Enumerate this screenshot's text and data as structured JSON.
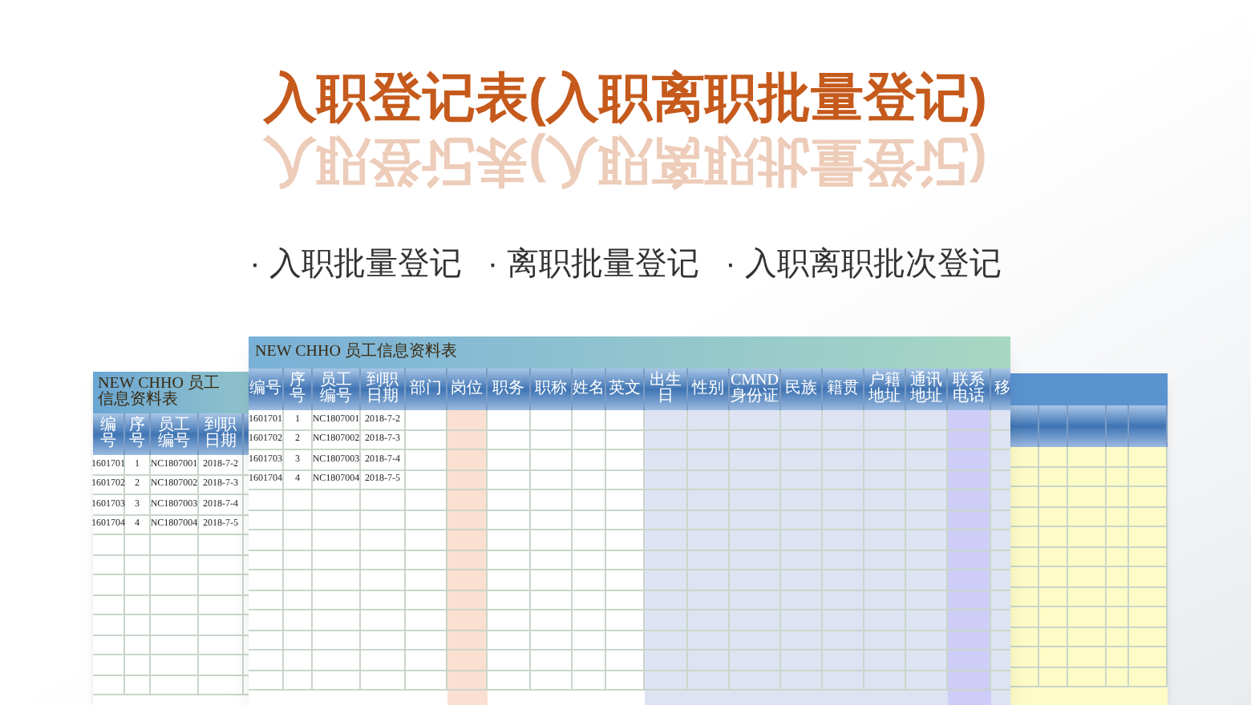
{
  "title": "入职登记表(入职离职批量登记)",
  "title_reflection": "入职登记表(入职离职批量登记)",
  "features": [
    "· 入职批量登记",
    "· 离职批量登记",
    "· 入职离职批次登记"
  ],
  "back_sheet": {
    "title": "NEW CHHO 员工信息资料表",
    "columns": [
      "编号",
      "序号",
      "员工编号",
      "到职日期"
    ],
    "rows": [
      [
        "1601701",
        "1",
        "NC1807001",
        "2018-7-2"
      ],
      [
        "1601702",
        "2",
        "NC1807002",
        "2018-7-3"
      ],
      [
        "1601703",
        "3",
        "NC1807003",
        "2018-7-4"
      ],
      [
        "1601704",
        "4",
        "NC1807004",
        "2018-7-5"
      ]
    ]
  },
  "main_sheet": {
    "title": "NEW CHHO 员工信息资料表",
    "columns": [
      {
        "label": "编号",
        "color": "#ffffff"
      },
      {
        "label": "序号",
        "color": "#ffffff"
      },
      {
        "label": "员工编号",
        "color": "#ffffff"
      },
      {
        "label": "到职日期",
        "color": "#ffffff"
      },
      {
        "label": "部门",
        "color": "#ffffff"
      },
      {
        "label": "岗位",
        "color": "#fbe0d2"
      },
      {
        "label": "职务",
        "color": "#ffffff"
      },
      {
        "label": "职称",
        "color": "#ffffff"
      },
      {
        "label": "姓名",
        "color": "#ffffff"
      },
      {
        "label": "英文",
        "color": "#ffffff"
      },
      {
        "label": "出生日",
        "color": "#dde3f3"
      },
      {
        "label": "性别",
        "color": "#dde3f3"
      },
      {
        "label": "CMND 身份证",
        "color": "#dde3f3"
      },
      {
        "label": "民族",
        "color": "#dde3f3"
      },
      {
        "label": "籍贯",
        "color": "#dde3f3"
      },
      {
        "label": "户籍地址",
        "color": "#dde3f3"
      },
      {
        "label": "通讯地址",
        "color": "#dde3f3"
      },
      {
        "label": "联系电话",
        "color": "#cfcdf8"
      },
      {
        "label": "移",
        "color": "#dde3f3"
      }
    ],
    "rows": [
      [
        "1601701",
        "1",
        "NC1807001",
        "2018-7-2"
      ],
      [
        "1601702",
        "2",
        "NC1807002",
        "2018-7-3"
      ],
      [
        "1601703",
        "3",
        "NC1807003",
        "2018-7-4"
      ],
      [
        "1601704",
        "4",
        "NC1807004",
        "2018-7-5"
      ]
    ]
  }
}
